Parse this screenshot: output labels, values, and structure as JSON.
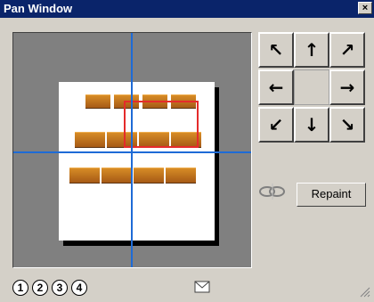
{
  "window": {
    "title": "Pan Window",
    "close_label": "×"
  },
  "pan": {
    "arrows": {
      "nw": "↖",
      "n": "↑",
      "ne": "↗",
      "w": "←",
      "e": "→",
      "sw": "↙",
      "s": "↓",
      "se": "↘"
    },
    "repaint_label": "Repaint"
  },
  "pages": [
    "1",
    "2",
    "3",
    "4"
  ],
  "colors": {
    "title_bar": "#0a246a",
    "guide_line": "#1e6bd6",
    "view_rect": "#e52b2b",
    "canvas_bg": "#808080"
  },
  "icons": {
    "link": "link-icon",
    "mail": "envelope-icon",
    "resize": "resize-grip-icon"
  }
}
